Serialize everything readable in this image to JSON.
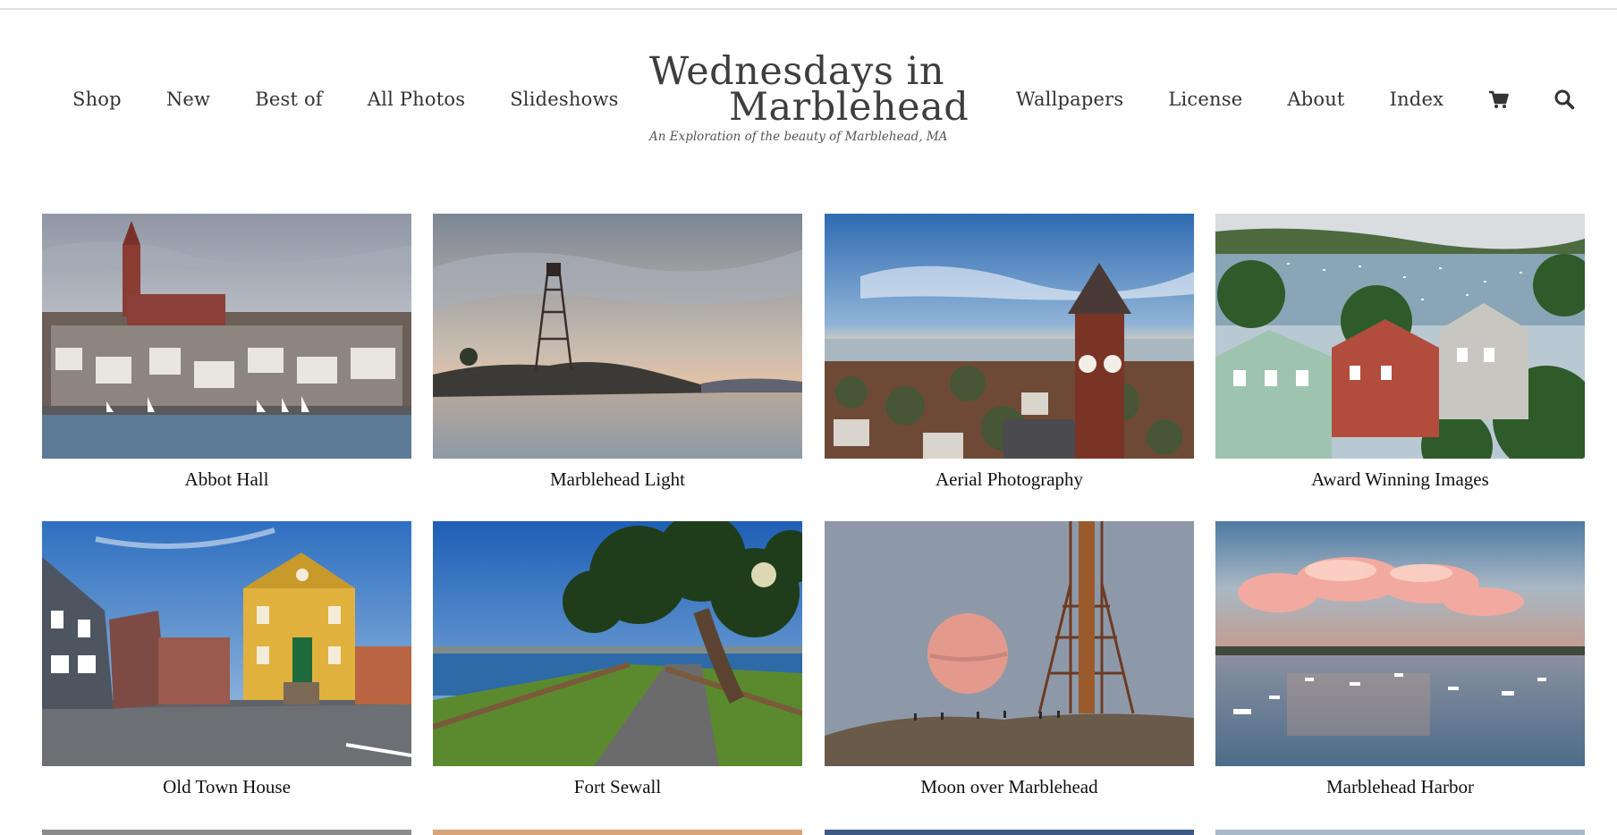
{
  "site": {
    "logo_line1": "Wednesdays in",
    "logo_line2": "Marblehead",
    "tagline": "An Exploration of the beauty of Marblehead, MA"
  },
  "nav_left": [
    {
      "label": "Shop"
    },
    {
      "label": "New"
    },
    {
      "label": "Best of"
    },
    {
      "label": "All Photos"
    },
    {
      "label": "Slideshows"
    }
  ],
  "nav_right": [
    {
      "label": "Wallpapers"
    },
    {
      "label": "License"
    },
    {
      "label": "About"
    },
    {
      "label": "Index"
    }
  ],
  "icons": {
    "cart": "cart-icon",
    "search": "search-icon"
  },
  "gallery": [
    {
      "title": "Abbot Hall",
      "scene": "town-waterfront"
    },
    {
      "title": "Marblehead Light",
      "scene": "lighthouse-sunset"
    },
    {
      "title": "Aerial Photography",
      "scene": "aerial-tower"
    },
    {
      "title": "Award Winning Images",
      "scene": "harbor-houses"
    },
    {
      "title": "Old Town House",
      "scene": "yellow-house"
    },
    {
      "title": "Fort Sewall",
      "scene": "tree-path"
    },
    {
      "title": "Moon over Marblehead",
      "scene": "moon-tower"
    },
    {
      "title": "Marblehead Harbor",
      "scene": "harbor-sunset"
    }
  ],
  "colors": {
    "text": "#333333",
    "caption": "#111111",
    "divider": "#e2e2e2"
  }
}
